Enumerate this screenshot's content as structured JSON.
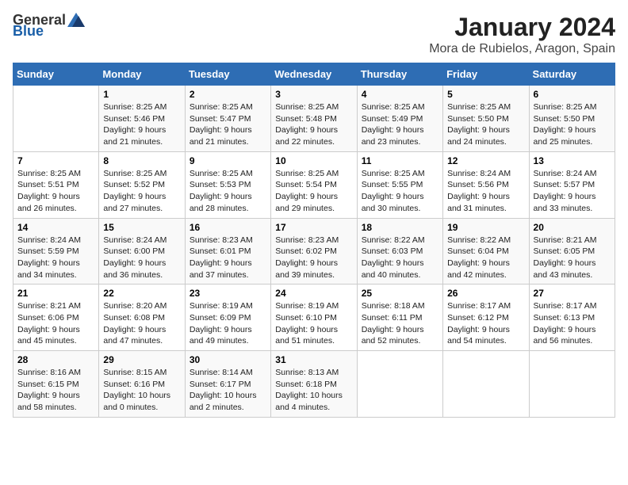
{
  "header": {
    "logo_general": "General",
    "logo_blue": "Blue",
    "month_title": "January 2024",
    "location": "Mora de Rubielos, Aragon, Spain"
  },
  "days_of_week": [
    "Sunday",
    "Monday",
    "Tuesday",
    "Wednesday",
    "Thursday",
    "Friday",
    "Saturday"
  ],
  "weeks": [
    [
      {
        "day": "",
        "sunrise": "",
        "sunset": "",
        "daylight": ""
      },
      {
        "day": "1",
        "sunrise": "Sunrise: 8:25 AM",
        "sunset": "Sunset: 5:46 PM",
        "daylight": "Daylight: 9 hours and 21 minutes."
      },
      {
        "day": "2",
        "sunrise": "Sunrise: 8:25 AM",
        "sunset": "Sunset: 5:47 PM",
        "daylight": "Daylight: 9 hours and 21 minutes."
      },
      {
        "day": "3",
        "sunrise": "Sunrise: 8:25 AM",
        "sunset": "Sunset: 5:48 PM",
        "daylight": "Daylight: 9 hours and 22 minutes."
      },
      {
        "day": "4",
        "sunrise": "Sunrise: 8:25 AM",
        "sunset": "Sunset: 5:49 PM",
        "daylight": "Daylight: 9 hours and 23 minutes."
      },
      {
        "day": "5",
        "sunrise": "Sunrise: 8:25 AM",
        "sunset": "Sunset: 5:50 PM",
        "daylight": "Daylight: 9 hours and 24 minutes."
      },
      {
        "day": "6",
        "sunrise": "Sunrise: 8:25 AM",
        "sunset": "Sunset: 5:50 PM",
        "daylight": "Daylight: 9 hours and 25 minutes."
      }
    ],
    [
      {
        "day": "7",
        "sunrise": "Sunrise: 8:25 AM",
        "sunset": "Sunset: 5:51 PM",
        "daylight": "Daylight: 9 hours and 26 minutes."
      },
      {
        "day": "8",
        "sunrise": "Sunrise: 8:25 AM",
        "sunset": "Sunset: 5:52 PM",
        "daylight": "Daylight: 9 hours and 27 minutes."
      },
      {
        "day": "9",
        "sunrise": "Sunrise: 8:25 AM",
        "sunset": "Sunset: 5:53 PM",
        "daylight": "Daylight: 9 hours and 28 minutes."
      },
      {
        "day": "10",
        "sunrise": "Sunrise: 8:25 AM",
        "sunset": "Sunset: 5:54 PM",
        "daylight": "Daylight: 9 hours and 29 minutes."
      },
      {
        "day": "11",
        "sunrise": "Sunrise: 8:25 AM",
        "sunset": "Sunset: 5:55 PM",
        "daylight": "Daylight: 9 hours and 30 minutes."
      },
      {
        "day": "12",
        "sunrise": "Sunrise: 8:24 AM",
        "sunset": "Sunset: 5:56 PM",
        "daylight": "Daylight: 9 hours and 31 minutes."
      },
      {
        "day": "13",
        "sunrise": "Sunrise: 8:24 AM",
        "sunset": "Sunset: 5:57 PM",
        "daylight": "Daylight: 9 hours and 33 minutes."
      }
    ],
    [
      {
        "day": "14",
        "sunrise": "Sunrise: 8:24 AM",
        "sunset": "Sunset: 5:59 PM",
        "daylight": "Daylight: 9 hours and 34 minutes."
      },
      {
        "day": "15",
        "sunrise": "Sunrise: 8:24 AM",
        "sunset": "Sunset: 6:00 PM",
        "daylight": "Daylight: 9 hours and 36 minutes."
      },
      {
        "day": "16",
        "sunrise": "Sunrise: 8:23 AM",
        "sunset": "Sunset: 6:01 PM",
        "daylight": "Daylight: 9 hours and 37 minutes."
      },
      {
        "day": "17",
        "sunrise": "Sunrise: 8:23 AM",
        "sunset": "Sunset: 6:02 PM",
        "daylight": "Daylight: 9 hours and 39 minutes."
      },
      {
        "day": "18",
        "sunrise": "Sunrise: 8:22 AM",
        "sunset": "Sunset: 6:03 PM",
        "daylight": "Daylight: 9 hours and 40 minutes."
      },
      {
        "day": "19",
        "sunrise": "Sunrise: 8:22 AM",
        "sunset": "Sunset: 6:04 PM",
        "daylight": "Daylight: 9 hours and 42 minutes."
      },
      {
        "day": "20",
        "sunrise": "Sunrise: 8:21 AM",
        "sunset": "Sunset: 6:05 PM",
        "daylight": "Daylight: 9 hours and 43 minutes."
      }
    ],
    [
      {
        "day": "21",
        "sunrise": "Sunrise: 8:21 AM",
        "sunset": "Sunset: 6:06 PM",
        "daylight": "Daylight: 9 hours and 45 minutes."
      },
      {
        "day": "22",
        "sunrise": "Sunrise: 8:20 AM",
        "sunset": "Sunset: 6:08 PM",
        "daylight": "Daylight: 9 hours and 47 minutes."
      },
      {
        "day": "23",
        "sunrise": "Sunrise: 8:19 AM",
        "sunset": "Sunset: 6:09 PM",
        "daylight": "Daylight: 9 hours and 49 minutes."
      },
      {
        "day": "24",
        "sunrise": "Sunrise: 8:19 AM",
        "sunset": "Sunset: 6:10 PM",
        "daylight": "Daylight: 9 hours and 51 minutes."
      },
      {
        "day": "25",
        "sunrise": "Sunrise: 8:18 AM",
        "sunset": "Sunset: 6:11 PM",
        "daylight": "Daylight: 9 hours and 52 minutes."
      },
      {
        "day": "26",
        "sunrise": "Sunrise: 8:17 AM",
        "sunset": "Sunset: 6:12 PM",
        "daylight": "Daylight: 9 hours and 54 minutes."
      },
      {
        "day": "27",
        "sunrise": "Sunrise: 8:17 AM",
        "sunset": "Sunset: 6:13 PM",
        "daylight": "Daylight: 9 hours and 56 minutes."
      }
    ],
    [
      {
        "day": "28",
        "sunrise": "Sunrise: 8:16 AM",
        "sunset": "Sunset: 6:15 PM",
        "daylight": "Daylight: 9 hours and 58 minutes."
      },
      {
        "day": "29",
        "sunrise": "Sunrise: 8:15 AM",
        "sunset": "Sunset: 6:16 PM",
        "daylight": "Daylight: 10 hours and 0 minutes."
      },
      {
        "day": "30",
        "sunrise": "Sunrise: 8:14 AM",
        "sunset": "Sunset: 6:17 PM",
        "daylight": "Daylight: 10 hours and 2 minutes."
      },
      {
        "day": "31",
        "sunrise": "Sunrise: 8:13 AM",
        "sunset": "Sunset: 6:18 PM",
        "daylight": "Daylight: 10 hours and 4 minutes."
      },
      {
        "day": "",
        "sunrise": "",
        "sunset": "",
        "daylight": ""
      },
      {
        "day": "",
        "sunrise": "",
        "sunset": "",
        "daylight": ""
      },
      {
        "day": "",
        "sunrise": "",
        "sunset": "",
        "daylight": ""
      }
    ]
  ]
}
